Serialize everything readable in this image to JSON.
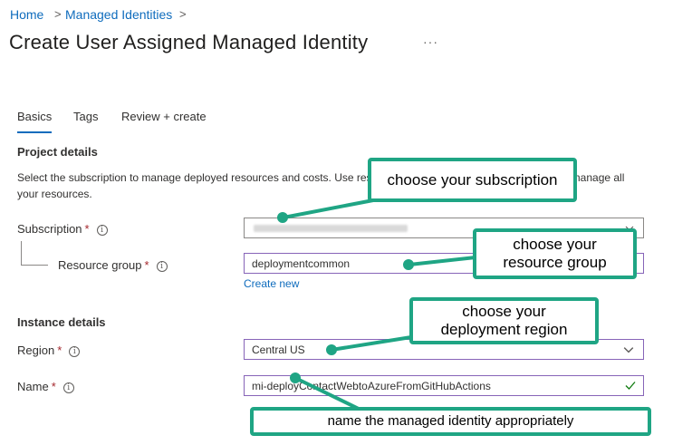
{
  "breadcrumb": {
    "items": [
      "Home",
      "Managed Identities"
    ],
    "separator": ">"
  },
  "header": {
    "title": "Create User Assigned Managed Identity",
    "more_label": "···"
  },
  "tabs": [
    {
      "label": "Basics",
      "active": true
    },
    {
      "label": "Tags",
      "active": false
    },
    {
      "label": "Review + create",
      "active": false
    }
  ],
  "project_details": {
    "heading": "Project details",
    "description": "Select the subscription to manage deployed resources and costs. Use resource groups like folders to organize and manage all your resources.",
    "subscription": {
      "label": "Subscription",
      "required_mark": "*",
      "value": ""
    },
    "resource_group": {
      "label": "Resource group",
      "required_mark": "*",
      "value": "deploymentcommon"
    },
    "create_new_label": "Create new"
  },
  "instance_details": {
    "heading": "Instance details",
    "region": {
      "label": "Region",
      "required_mark": "*",
      "value": "Central US"
    },
    "name": {
      "label": "Name",
      "required_mark": "*",
      "value": "mi-deployContactWebtoAzureFromGitHubActions"
    }
  },
  "callouts": {
    "subscription": "choose your subscription",
    "resource_group_line1": "choose your",
    "resource_group_line2": "resource group",
    "region_line1": "choose your",
    "region_line2": "deployment region",
    "name": "name the managed identity appropriately"
  },
  "colors": {
    "link": "#0f6cbd",
    "callout_border": "#1fa584",
    "valid_check": "#107c10",
    "focused_border": "#8764b8",
    "required": "#a4262c"
  },
  "icons": {
    "info": "info-circle-icon",
    "dropdown": "chevron-down-icon",
    "valid": "checkmark-icon"
  }
}
